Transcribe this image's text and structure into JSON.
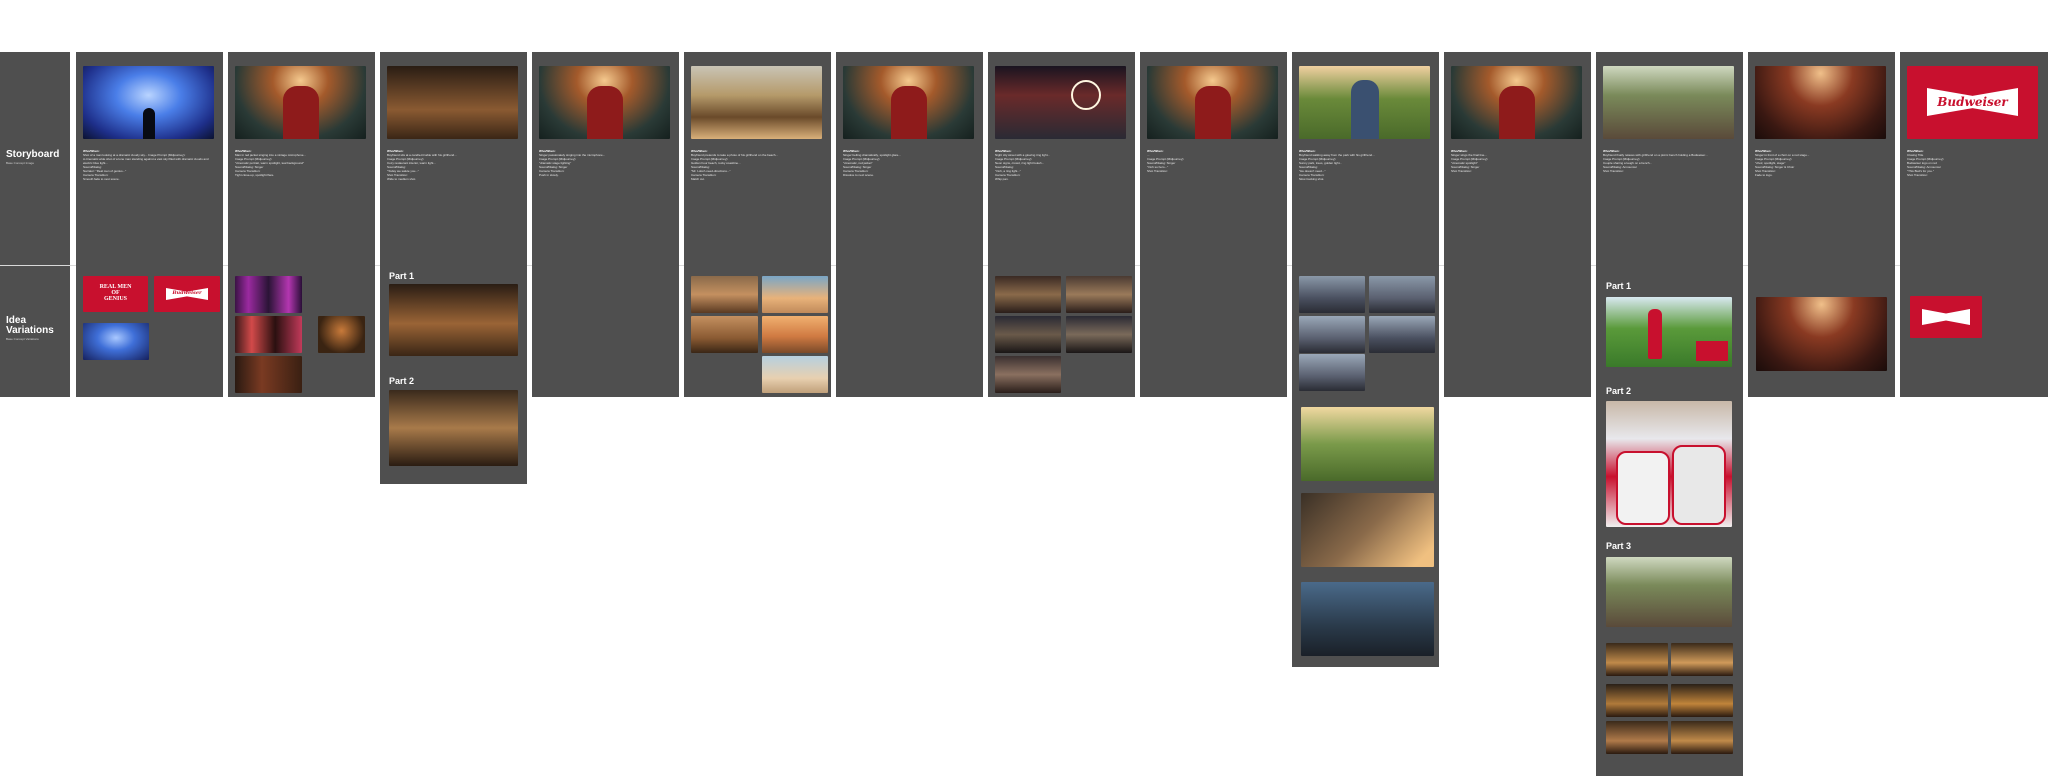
{
  "labels": {
    "storyboard": {
      "title": "Storyboard",
      "sub": "Base Concept Image"
    },
    "idea": {
      "title": "Idea\nVariations",
      "sub": "Base Concept Variations"
    }
  },
  "parts": {
    "p1": "Part 1",
    "p2": "Part 2",
    "p3": "Part 3"
  },
  "logos": {
    "genius": "REAL MEN\nOF\nGENIUS",
    "budweiser": "Budweiser"
  },
  "scenes": [
    {
      "who": "Who/When:",
      "text": "Shot of a man looking at a dramatic cloudy sky... Image Prompt (Midjourney):\nA cinematic wide shot of a lone man standing against a vast sky filled with dramatic clouds and electric blue light...\nSound/Dialog:\nNarrator: \"Real men of genius...\"\nCamera Transition:\nSmooth fade to next scene."
    },
    {
      "who": "Who/When:",
      "text": "Man in red jacket singing into a vintage microphone...\nImage Prompt (Midjourney):\n\"cinematic portrait, warm spotlight, teal background\"\nSound/Dialog: Singer\nCamera Transition:\nTight close-up, spotlight flare."
    },
    {
      "who": "Who/When:",
      "text": "Boyfriend sits at a candle-lit table with his girlfriend...\nImage Prompt (Midjourney):\nCozy restaurant interior, warm light...\nSound/Dialog:\n\"Today we salute you...\"\nShot Transition:\nWide to medium shot."
    },
    {
      "who": "Who/When:",
      "text": "Singer passionately singing into the microphone...\nImage Prompt (Midjourney):\n\"dramatic stage lighting\"\nSound/Dialog: Singer\nCamera Transition:\nPush in slowly."
    },
    {
      "who": "Who/When:",
      "text": "Boyfriend pretends to take a photo of his girlfriend on the beach...\nImage Prompt (Midjourney):\nGolden hour beach, rocky coastline...\nSound/Dialog:\n\"Mr. I-don't-need-directions...\"\nCamera Transition:\nMatch cut."
    },
    {
      "who": "Who/When:",
      "text": "Singer belting dramatically, spotlight glare...\nImage Prompt (Midjourney):\n\"cinematic, red jacket\"\nSound/Dialog: Singer\nCamera Transition:\nDissolve to next scene."
    },
    {
      "who": "Who/When:",
      "text": "Night city street with a glowing ring light...\nImage Prompt (Midjourney):\nNeon signs, crowd, ring light bokeh...\nSound/Dialog:\n\"Ooh, a ring light...\"\nCamera Transition:\nWhip pan."
    },
    {
      "who": "Who/When:",
      "text": "...\nImage Prompt (Midjourney):\nSound/Dialog: Singer\n\"Ooh so hero...\"\nShot Transition:"
    },
    {
      "who": "Who/When:",
      "text": "Boyfriend walking away from the park with his girlfriend...\nImage Prompt (Midjourney):\nSunny park, trees, golden light...\nSound/Dialog:\n\"He doesn't need...\"\nCamera Transition:\nSlow tracking shot."
    },
    {
      "who": "Who/When:",
      "text": "Singer sings the final line...\nImage Prompt (Midjourney):\n\"cinematic spotlight\"\nSound/Dialog: Singer\nShot Transition:"
    },
    {
      "who": "Who/When:",
      "text": "Boyfriend finally relaxes with girlfriend on a picnic bench holding a Budweiser...\nImage Prompt (Midjourney):\nCouple sharing a laugh on a bench...\nSound/Dialog: Announcer\nShot Transition:"
    },
    {
      "who": "Who/When:",
      "text": "Singer in front of a choir on a red stage...\nImage Prompt (Midjourney):\n\"choir, spotlight, stage\"\nSound/Dialog: Singer & Choir\nShot Transition:\nFade to logo."
    },
    {
      "who": "Who/When:",
      "text": "Closing Title\nImage Prompt (Midjourney):\nBudweiser logo on red\nSound/Dialog: Announcer\n\"This Bud's for you.\"\nShot Transition:"
    }
  ],
  "colors": {
    "panel": "#4f4f4f",
    "budweiser_red": "#c8102e",
    "background": "#ffffff"
  }
}
